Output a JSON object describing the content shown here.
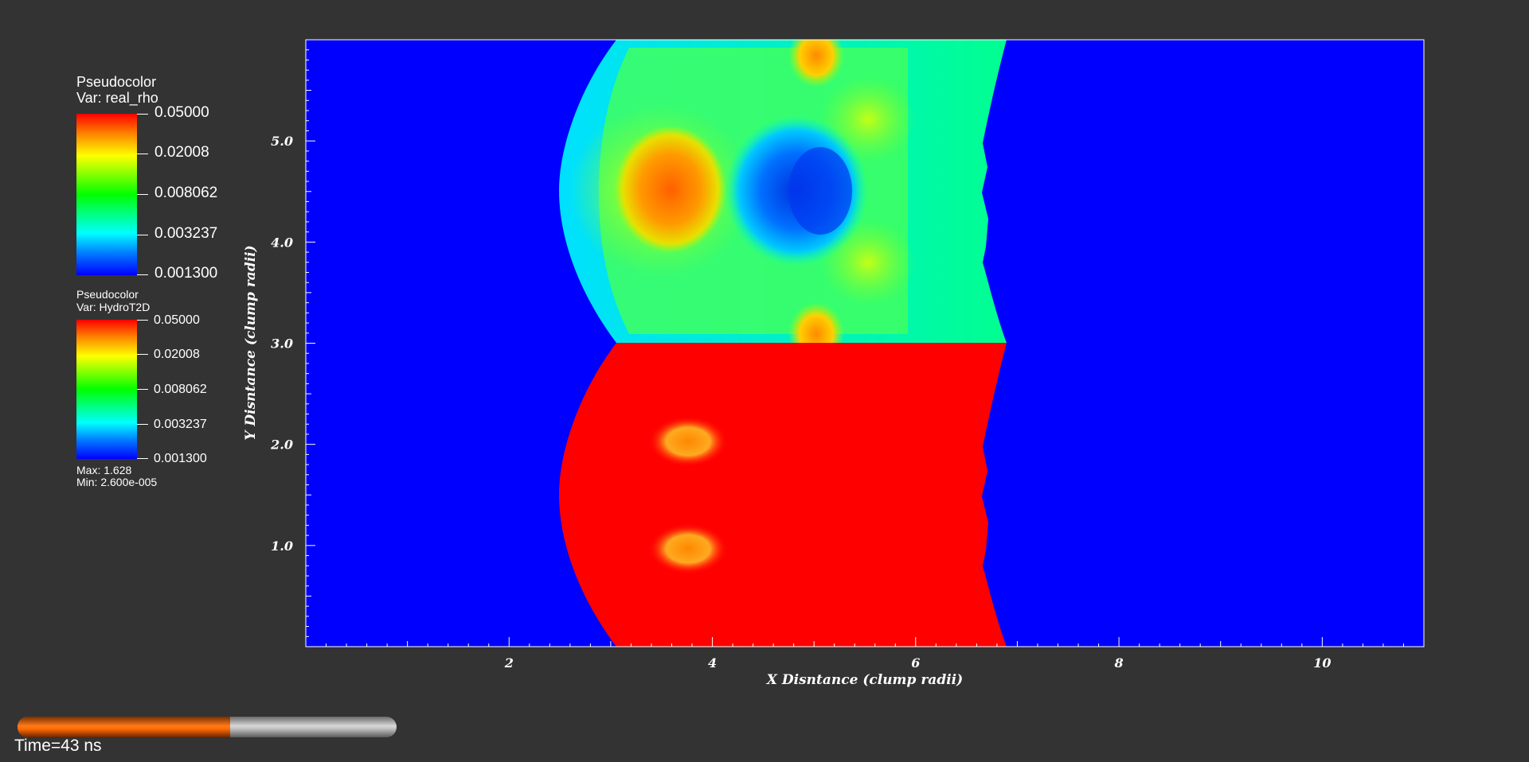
{
  "legends": [
    {
      "title": "Pseudocolor",
      "var_label": "Var: real_rho",
      "labels": [
        "0.05000",
        "0.02008",
        "0.008062",
        "0.003237",
        "0.001300"
      ]
    },
    {
      "title": "Pseudocolor",
      "var_label": "Var: HydroT2D",
      "labels": [
        "0.05000",
        "0.02008",
        "0.008062",
        "0.003237",
        "0.001300"
      ],
      "max_label": "Max:  1.628",
      "min_label": "Min:  2.600e-005"
    }
  ],
  "chart_data": {
    "type": "heatmap",
    "xlabel": "X Disntance (clump radii)",
    "ylabel": "Y Disntance (clump radii)",
    "xlim": [
      0,
      11
    ],
    "ylim": [
      0,
      6
    ],
    "xticks": [
      2,
      4,
      6,
      8,
      10
    ],
    "xtick_labels": [
      "2",
      "4",
      "6",
      "8",
      "10"
    ],
    "yticks": [
      1,
      2,
      3,
      4,
      5
    ],
    "ytick_labels": [
      "1.0",
      "2.0",
      "3.0",
      "4.0",
      "5.0"
    ],
    "colorbar_values": [
      0.05,
      0.02008,
      0.008062,
      0.003237,
      0.0013
    ],
    "colormap": [
      "#ff0000",
      "#ffff00",
      "#00ff00",
      "#00ffff",
      "#0000ff"
    ],
    "background_color": "#0000ff",
    "panels": [
      {
        "variable": "real_rho",
        "y_range": [
          3,
          6
        ]
      },
      {
        "variable": "HydroT2D",
        "y_range": [
          0,
          3
        ]
      }
    ],
    "legend_position": "left"
  },
  "time": {
    "label": "Time=43 ns",
    "progress": 0.56
  }
}
